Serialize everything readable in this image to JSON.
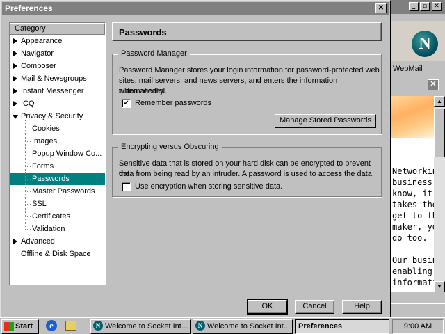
{
  "dialog": {
    "title": "Preferences",
    "close_glyph": "✕"
  },
  "category": {
    "header": "Category",
    "items": [
      {
        "label": "Appearance",
        "level": 0,
        "expander": "collapsed"
      },
      {
        "label": "Navigator",
        "level": 0,
        "expander": "collapsed"
      },
      {
        "label": "Composer",
        "level": 0,
        "expander": "collapsed"
      },
      {
        "label": "Mail & Newsgroups",
        "level": 0,
        "expander": "collapsed"
      },
      {
        "label": "Instant Messenger",
        "level": 0,
        "expander": "collapsed"
      },
      {
        "label": "ICQ",
        "level": 0,
        "expander": "collapsed"
      },
      {
        "label": "Privacy & Security",
        "level": 0,
        "expander": "expanded"
      },
      {
        "label": "Cookies",
        "level": 1
      },
      {
        "label": "Images",
        "level": 1
      },
      {
        "label": "Popup Window Co...",
        "level": 1
      },
      {
        "label": "Forms",
        "level": 1
      },
      {
        "label": "Passwords",
        "level": 1,
        "selected": true
      },
      {
        "label": "Master Passwords",
        "level": 1
      },
      {
        "label": "SSL",
        "level": 1
      },
      {
        "label": "Certificates",
        "level": 1
      },
      {
        "label": "Validation",
        "level": 1
      },
      {
        "label": "Advanced",
        "level": 0,
        "expander": "collapsed"
      },
      {
        "label": "Offline & Disk Space",
        "level": 0,
        "expander": "none"
      }
    ]
  },
  "panel": {
    "title": "Passwords",
    "password_manager": {
      "legend": "Password Manager",
      "description_lines": [
        "Password Manager stores your login information for password-protected web",
        "sites, mail servers, and news servers, and enters the information automatically",
        "when needed."
      ],
      "remember_label": "Remember passwords",
      "remember_checked": true,
      "check_glyph": "✔",
      "manage_button": "Manage Stored Passwords"
    },
    "encrypting": {
      "legend": "Encrypting versus Obscuring",
      "description_lines": [
        "Sensitive data that is stored on your hard disk can be encrypted to prevent the",
        "data from being read by an intruder. A password is used to access the data."
      ],
      "encryption_label": "Use encryption when storing sensitive data.",
      "encryption_checked": false
    }
  },
  "buttons": {
    "ok": "OK",
    "cancel": "Cancel",
    "help": "Help"
  },
  "background_window": {
    "controls": [
      "_",
      "▫",
      "✕"
    ],
    "webmail": "WebMail",
    "logo_letter": "N",
    "close_glyph": "✕",
    "text_lines": [
      "Networkin",
      "business.",
      "know, it's",
      "takes the",
      "get to th",
      "maker, yo",
      "do too.",
      "",
      "Our busin",
      "enabling",
      "informatio"
    ]
  },
  "taskbar": {
    "start": "Start",
    "windows": [
      {
        "label": "Welcome to Socket Int...",
        "active": false
      },
      {
        "label": "Welcome to Socket Int...",
        "active": false
      },
      {
        "label": "Preferences",
        "active": true
      }
    ],
    "clock": "9:00 AM"
  },
  "colors": {
    "selection": "#008080",
    "face": "#c0c0c0",
    "titlebar_inactive": "#808080"
  }
}
